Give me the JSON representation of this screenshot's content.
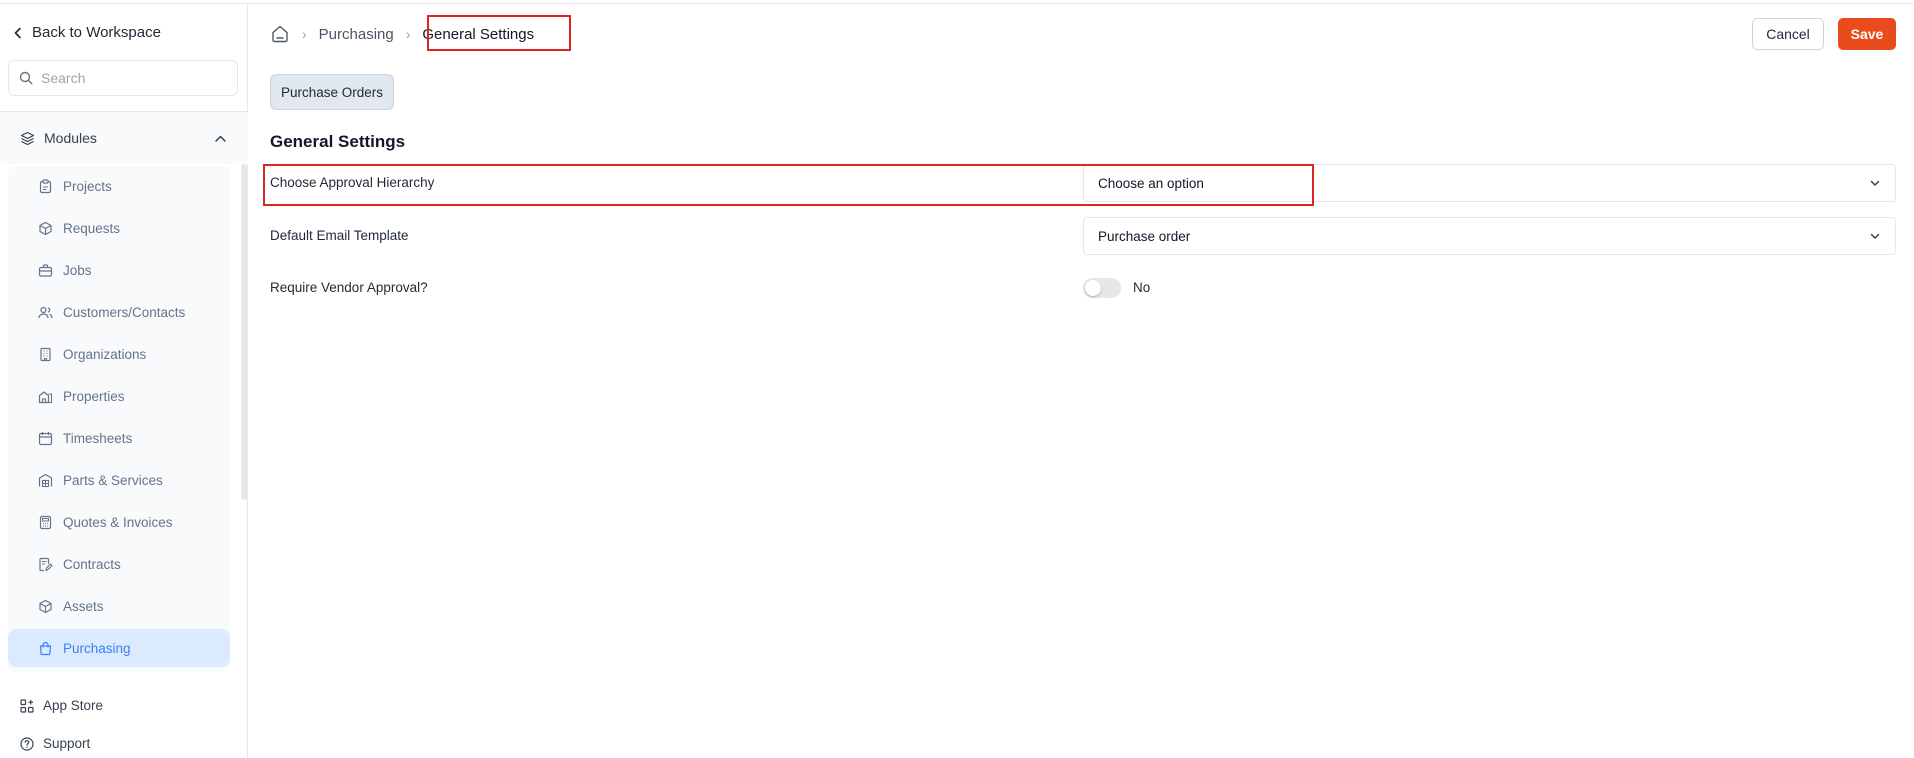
{
  "sidebar": {
    "back_label": "Back to Workspace",
    "search_placeholder": "Search",
    "modules_label": "Modules",
    "items": [
      {
        "label": "Projects",
        "icon": "clipboard-icon"
      },
      {
        "label": "Requests",
        "icon": "box-search-icon"
      },
      {
        "label": "Jobs",
        "icon": "briefcase-icon"
      },
      {
        "label": "Customers/Contacts",
        "icon": "users-icon"
      },
      {
        "label": "Organizations",
        "icon": "building-icon"
      },
      {
        "label": "Properties",
        "icon": "property-icon"
      },
      {
        "label": "Timesheets",
        "icon": "calendar-icon"
      },
      {
        "label": "Parts & Services",
        "icon": "warehouse-icon"
      },
      {
        "label": "Quotes & Invoices",
        "icon": "calculator-icon"
      },
      {
        "label": "Contracts",
        "icon": "contract-icon"
      },
      {
        "label": "Assets",
        "icon": "cube-icon"
      },
      {
        "label": "Purchasing",
        "icon": "shopping-bag-icon",
        "active": true
      }
    ],
    "bottom": {
      "app_store": "App Store",
      "support": "Support"
    }
  },
  "breadcrumb": {
    "parent": "Purchasing",
    "current": "General Settings"
  },
  "actions": {
    "cancel": "Cancel",
    "save": "Save"
  },
  "tabs": {
    "purchase_orders": "Purchase Orders"
  },
  "settings": {
    "title": "General Settings",
    "approval_label": "Choose Approval Hierarchy",
    "approval_value": "Choose an option",
    "email_label": "Default Email Template",
    "email_value": "Purchase order",
    "vendor_label": "Require Vendor Approval?",
    "vendor_value": "No"
  },
  "colors": {
    "accent": "#ea4b1c",
    "active_nav": "#3b82f6",
    "highlight": "#dc2626"
  }
}
